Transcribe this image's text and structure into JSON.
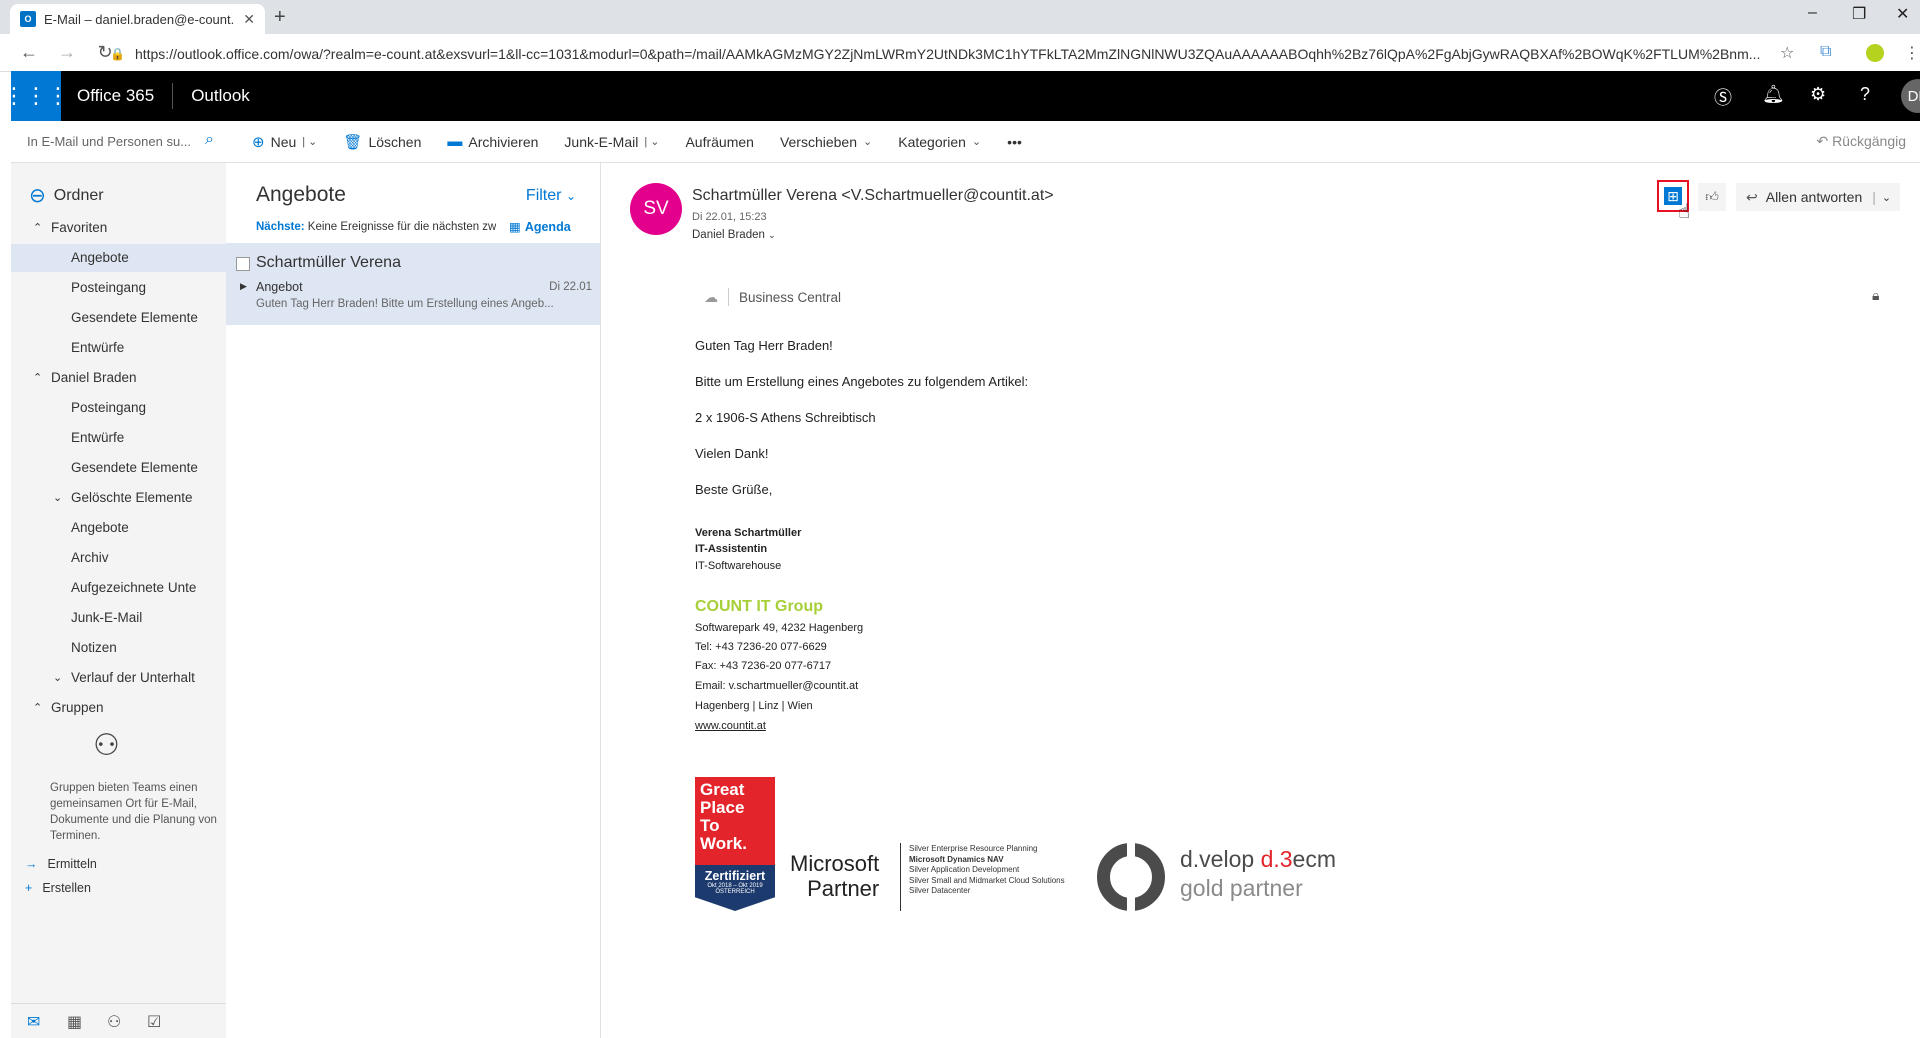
{
  "browser": {
    "tab_title": "E-Mail – daniel.braden@e-count.",
    "tab_favicon": "O",
    "new_tab": "+",
    "url": "https://outlook.office.com/owa/?realm=e-count.at&exsvurl=1&ll-cc=1031&modurl=0&path=/mail/AAMkAGMzMGY2ZjNmLWRmY2UtNDk3MC1hYTFkLTA2MmZlNGNlNWU3ZQAuAAAAAABOqhh%2Bz76lQpA%2FgAbjGywRAQBXAf%2BOWqK%2FTLUM%2Bnm...",
    "win_minimize": "–",
    "win_restore": "❐",
    "win_close": "✕"
  },
  "header": {
    "brand": "Office 365",
    "app": "Outlook",
    "avatar": "DB"
  },
  "search": {
    "placeholder": "In E-Mail und Personen su..."
  },
  "commands": {
    "new": "Neu",
    "delete": "Löschen",
    "archive": "Archivieren",
    "junk": "Junk-E-Mail",
    "sweep": "Aufräumen",
    "move": "Verschieben",
    "categories": "Kategorien",
    "more": "•••",
    "undo": "Rückgängig"
  },
  "nav": {
    "title": "Ordner",
    "items": [
      {
        "label": "Favoriten",
        "prefix": "^",
        "indent": 1
      },
      {
        "label": "Angebote",
        "prefix": "",
        "indent": 2
      },
      {
        "label": "Posteingang",
        "prefix": "",
        "indent": 2
      },
      {
        "label": "Gesendete Elemente",
        "prefix": "",
        "indent": 2
      },
      {
        "label": "Entwürfe",
        "prefix": "",
        "indent": 2
      },
      {
        "label": "Daniel Braden",
        "prefix": "^",
        "indent": 1
      },
      {
        "label": "Posteingang",
        "prefix": "",
        "indent": 2
      },
      {
        "label": "Entwürfe",
        "prefix": "",
        "indent": 2
      },
      {
        "label": "Gesendete Elemente",
        "prefix": "",
        "indent": 2
      },
      {
        "label": "Gelöschte Elemente",
        "prefix": "v",
        "indent": 1.5
      },
      {
        "label": "Angebote",
        "prefix": "",
        "indent": 2
      },
      {
        "label": "Archiv",
        "prefix": "",
        "indent": 2
      },
      {
        "label": "Aufgezeichnete Unte",
        "prefix": "",
        "indent": 2
      },
      {
        "label": "Junk-E-Mail",
        "prefix": "",
        "indent": 2
      },
      {
        "label": "Notizen",
        "prefix": "",
        "indent": 2
      },
      {
        "label": "Verlauf der Unterhalt",
        "prefix": "v",
        "indent": 1.5
      },
      {
        "label": "Gruppen",
        "prefix": "^",
        "indent": 1
      }
    ],
    "groups_desc": "Gruppen bieten Teams einen gemeinsamen Ort für E-Mail, Dokumente und die Planung von Terminen.",
    "discover": "Ermitteln",
    "create": "Erstellen"
  },
  "list": {
    "title": "Angebote",
    "filter": "Filter",
    "next_label": "Nächste:",
    "next_text": "Keine Ereignisse für die nächsten zw",
    "agenda": "Agenda",
    "message": {
      "from": "Schartmüller Verena",
      "subject": "Angebot",
      "date": "Di 22.01",
      "preview": "Guten Tag Herr Braden!  Bitte um Erstellung eines Angeb..."
    }
  },
  "reading": {
    "avatar": "SV",
    "sender": "Schartmüller Verena <V.Schartmueller@countit.at>",
    "sent": "Di 22.01, 15:23",
    "to": "Daniel Braden",
    "reply_all": "Allen antworten",
    "addin": "Business Central",
    "body": [
      "Guten Tag Herr Braden!",
      "Bitte um Erstellung eines Angebotes zu folgendem Artikel:",
      "2 x 1906-S Athens Schreibtisch",
      "Vielen Dank!",
      "Beste Grüße,"
    ],
    "sig_name": "Verena Schartmüller",
    "sig_title": "IT-Assistentin",
    "sig_dept": "IT-Softwarehouse",
    "company": "COUNT IT Group",
    "address": "Softwarepark 49, 4232 Hagenberg",
    "tel": "Tel:     +43 7236-20 077-6629",
    "fax": "Fax:    +43 7236-20 077-6717",
    "email": "Email: v.schartmueller@countit.at",
    "locations": "Hagenberg | Linz | Wien",
    "website": "www.countit.at",
    "gptw": {
      "line1": "Great",
      "line2": "Place",
      "line3": "To",
      "line4": "Work.",
      "cert": "Zertifiziert",
      "period": "Okt 2018 – Okt 2019",
      "country": "ÖSTERREICH"
    },
    "ms": {
      "line1": "Microsoft",
      "line2": "Partner",
      "comp": [
        "Silver Enterprise Resource Planning",
        "Microsoft Dynamics NAV",
        "Silver Application Development",
        "Silver Small and Midmarket Cloud Solutions",
        "Silver Datacenter"
      ]
    },
    "dvelop": {
      "brand": "d.velop",
      "product": "d.3",
      "suffix": "ecm",
      "partner": "gold partner"
    }
  }
}
